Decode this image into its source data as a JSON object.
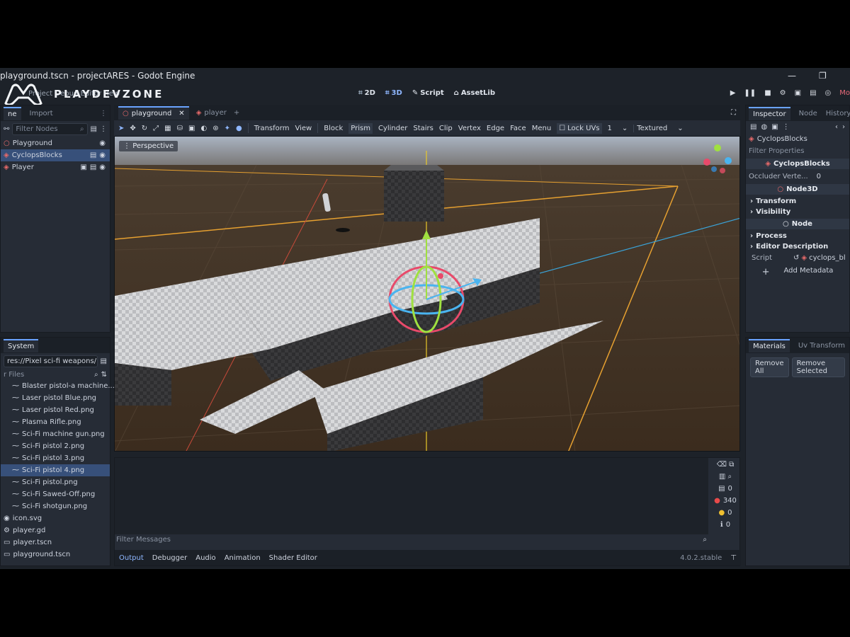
{
  "window": {
    "title": "playground.tscn - projectARES - Godot Engine",
    "controls": [
      "minimize-icon",
      "restore-icon"
    ]
  },
  "watermark": {
    "text": "PLAYDEVZONE"
  },
  "menu": {
    "left_partial": "Project Debug Editor Help"
  },
  "workspaces": [
    {
      "label": "2D",
      "icon": "2d-icon"
    },
    {
      "label": "3D",
      "icon": "3d-icon",
      "active": true
    },
    {
      "label": "Script",
      "icon": "script-icon"
    },
    {
      "label": "AssetLib",
      "icon": "assetlib-icon"
    }
  ],
  "play_controls": {
    "right_label": "Mo"
  },
  "scene_dock": {
    "tabs": [
      "ne",
      "Import"
    ],
    "filter_placeholder": "Filter Nodes",
    "nodes": [
      {
        "label": "Playground",
        "depth": 0
      },
      {
        "label": "CyclopsBlocks",
        "depth": 1,
        "selected": true
      },
      {
        "label": "Player",
        "depth": 1
      }
    ]
  },
  "filesystem_dock": {
    "title": "System",
    "path": "res://Pixel sci-fi weapons/Pix",
    "filter_placeholder": "r Files",
    "files": [
      "Blaster pistol-a machine...",
      "Laser pistol Blue.png",
      "Laser pistol Red.png",
      "Plasma Rifle.png",
      "Sci-Fi machine gun.png",
      "Sci-Fi pistol 2.png",
      "Sci-Fi pistol 3.png",
      "Sci-Fi pistol 4.png",
      "Sci-Fi pistol.png",
      "Sci-Fi Sawed-Off.png",
      "Sci-Fi shotgun.png"
    ],
    "selected_file": "Sci-Fi pistol 4.png",
    "root_files": [
      "icon.svg",
      "player.gd",
      "player.tscn",
      "playground.tscn"
    ]
  },
  "scene_tabs": [
    {
      "label": "playground",
      "active": true
    },
    {
      "label": "player",
      "active": false
    }
  ],
  "viewport_toolbar": {
    "items": [
      "Transform",
      "View",
      "Block",
      "Prism",
      "Cylinder",
      "Stairs",
      "Clip",
      "Vertex",
      "Edge",
      "Face",
      "Menu",
      "Lock UVs"
    ],
    "lock_value": "1",
    "shading": "Textured"
  },
  "viewport": {
    "perspective_label": "Perspective"
  },
  "output_panel": {
    "filter_placeholder": "Filter Messages",
    "tabs": [
      "Output",
      "Debugger",
      "Audio",
      "Animation",
      "Shader Editor"
    ],
    "active_tab": "Output",
    "counters": [
      "0",
      "340",
      "0",
      "0"
    ],
    "version": "4.0.2.stable"
  },
  "inspector": {
    "tabs": [
      "Inspector",
      "Node",
      "History"
    ],
    "object": "CyclopsBlocks",
    "filter_placeholder": "Filter Properties",
    "class_header": "CyclopsBlocks",
    "occluder_label": "Occluder Verte...",
    "occluder_value": "0",
    "node3d_header": "Node3D",
    "sections": [
      "Transform",
      "Visibility"
    ],
    "node_header": "Node",
    "sections2": [
      "Process",
      "Editor Description"
    ],
    "script_label": "Script",
    "script_value": "cyclops_bl",
    "add_metadata": "Add Metadata"
  },
  "materials_dock": {
    "tabs": [
      "Materials",
      "Uv Transform"
    ],
    "buttons": [
      "Remove All",
      "Remove Selected"
    ]
  }
}
